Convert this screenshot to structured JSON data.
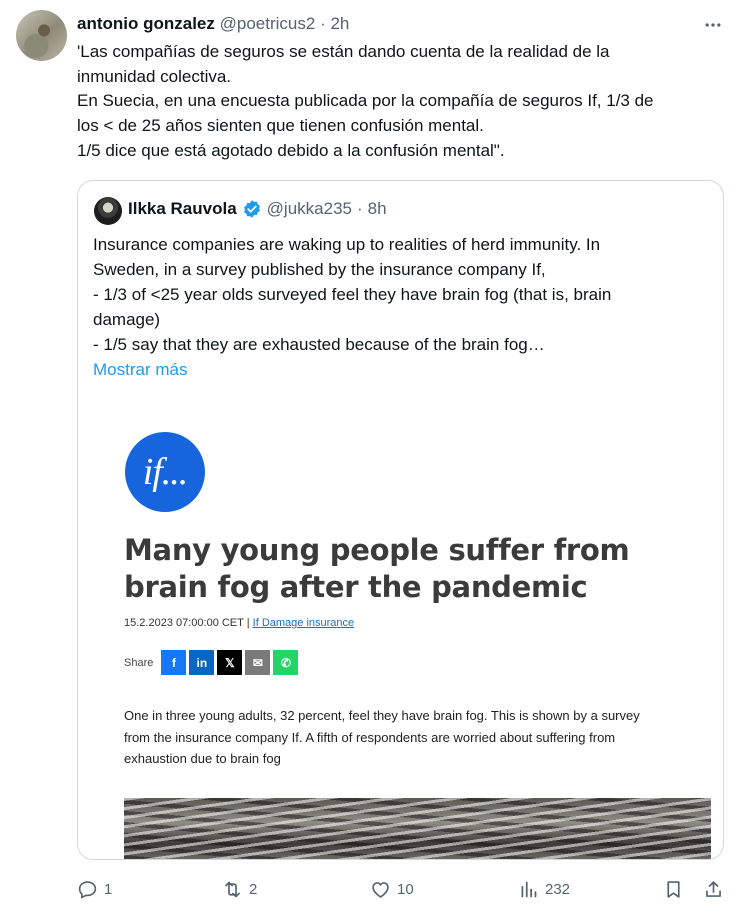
{
  "tweet": {
    "author_name": "antonio gonzalez",
    "author_handle": "@poetricus2",
    "separator": "·",
    "time": "2h",
    "text_lines": [
      "'Las compañías de seguros se están dando cuenta de la realidad de la",
      "inmunidad colectiva.",
      "En Suecia, en una encuesta publicada por la compañía de seguros If, 1/3 de",
      "los < de 25 años sienten que tienen confusión mental.",
      "1/5 dice que está agotado debido a la confusión mental\"."
    ]
  },
  "quote": {
    "author_name": "Ilkka Rauvola",
    "author_handle": "@jukka235",
    "separator": "·",
    "time": "8h",
    "verified_color": "#1d9bf0",
    "text_lines": [
      "Insurance companies are waking up to realities of herd immunity. In",
      "Sweden, in a survey published by the insurance company If,",
      "- 1/3 of <25 year olds surveyed feel they have brain fog (that is, brain",
      "damage)",
      "- 1/5 say that they are exhausted because of the brain fog…"
    ],
    "show_more": "Mostrar más",
    "article": {
      "logo_text": "if...",
      "logo_color": "#1765dc",
      "title": "Many young people suffer from brain fog after the pandemic",
      "date": "15.2.2023 07:00:00 CET |",
      "category": "If Damage insurance",
      "share_label": "Share",
      "share_buttons": [
        {
          "icon": "facebook-icon",
          "glyph": "f",
          "color": "#1877f2"
        },
        {
          "icon": "linkedin-icon",
          "glyph": "in",
          "color": "#0a66c2"
        },
        {
          "icon": "x-icon",
          "glyph": "𝕏",
          "color": "#000000"
        },
        {
          "icon": "email-icon",
          "glyph": "✉",
          "color": "#7a7a7a"
        },
        {
          "icon": "whatsapp-icon",
          "glyph": "✆",
          "color": "#25d366"
        }
      ],
      "body_lines": [
        "One in three young adults, 32 percent, feel they have brain fog. This is shown by a survey",
        "from the insurance company If. A fifth of respondents are worried about suffering from",
        "exhaustion due to brain fog"
      ]
    }
  },
  "actions": {
    "replies": "1",
    "reposts": "2",
    "likes": "10",
    "views": "232"
  },
  "colors": {
    "text_primary": "#0f1419",
    "text_secondary": "#536471",
    "link": "#1d9bf0",
    "border": "#cfd9de"
  }
}
